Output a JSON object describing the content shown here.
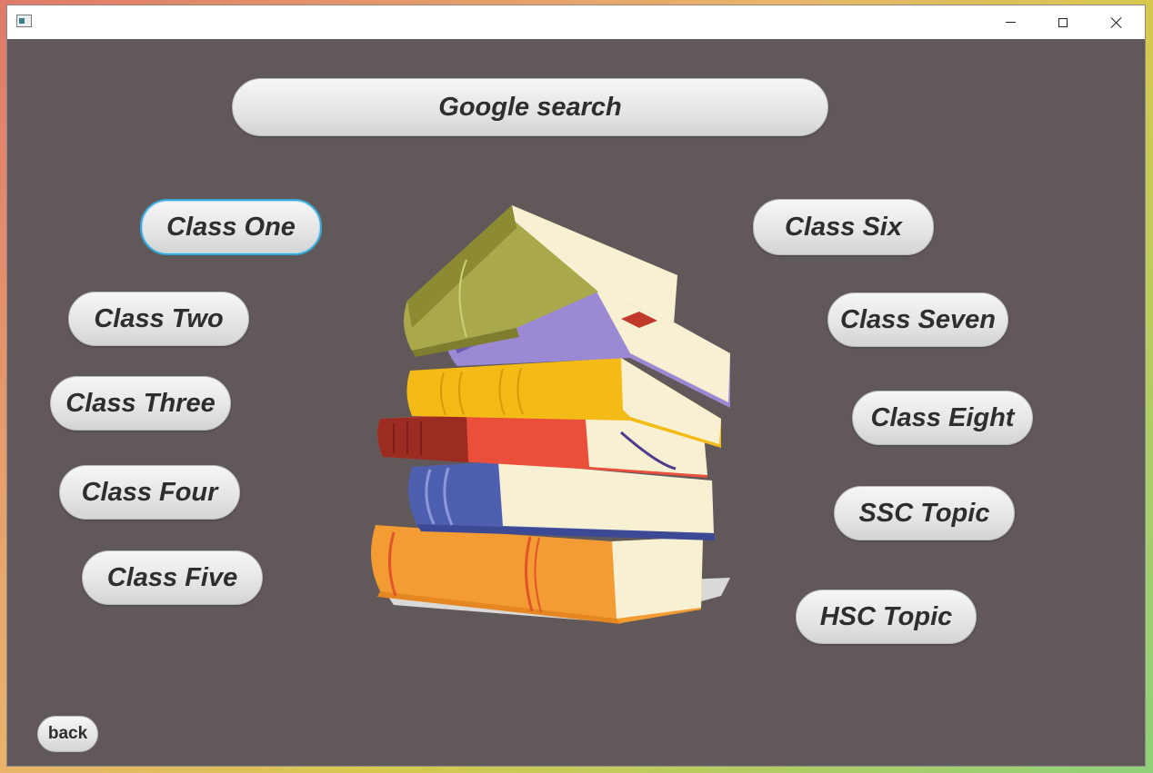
{
  "window": {
    "title": ""
  },
  "buttons": {
    "google_search": "Google search",
    "class_one": "Class One",
    "class_two": "Class Two",
    "class_three": "Class Three",
    "class_four": "Class Four",
    "class_five": "Class Five",
    "class_six": "Class Six",
    "class_seven": "Class Seven",
    "class_eight": "Class Eight",
    "ssc_topic": "SSC Topic",
    "hsc_topic": "HSC Topic",
    "back": "back"
  },
  "colors": {
    "window_bg": "#615959",
    "focus_ring": "#3aa6d6",
    "button_text": "#2e2e2e"
  },
  "icons": {
    "app": "app-window-icon",
    "minimize": "minimize-icon",
    "maximize": "maximize-icon",
    "close": "close-icon",
    "illustration": "book-stack-illustration"
  }
}
